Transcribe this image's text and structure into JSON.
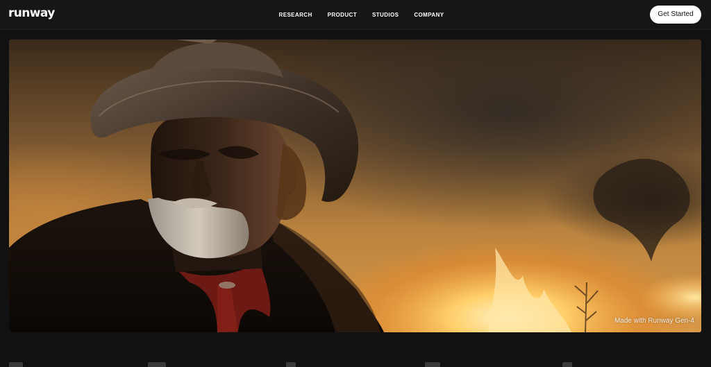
{
  "header": {
    "logo": "runway",
    "nav": [
      "RESEARCH",
      "PRODUCT",
      "STUDIOS",
      "COMPANY"
    ],
    "cta_label": "Get Started"
  },
  "hero": {
    "caption": "Made with Runway Gen-4"
  },
  "colors": {
    "background": "#111111",
    "topbar": "#161616",
    "cta_bg": "#ffffff",
    "cta_text": "#111111"
  }
}
